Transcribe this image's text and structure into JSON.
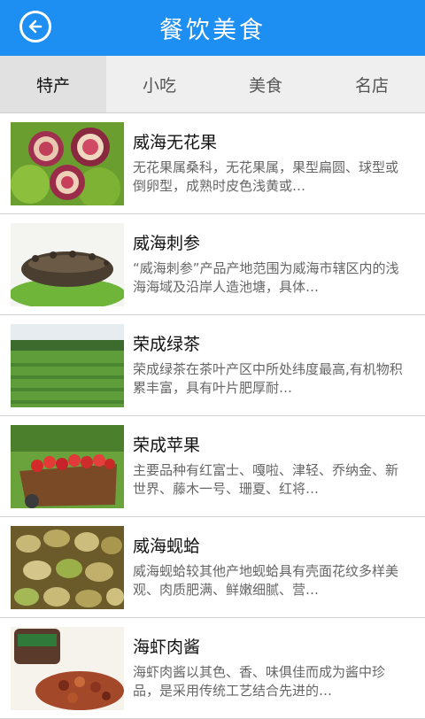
{
  "header": {
    "title": "餐饮美食",
    "back_icon": "back-arrow-icon"
  },
  "tabs": [
    {
      "label": "特产",
      "active": true
    },
    {
      "label": "小吃",
      "active": false
    },
    {
      "label": "美食",
      "active": false
    },
    {
      "label": "名店",
      "active": false
    }
  ],
  "items": [
    {
      "title": "威海无花果",
      "desc": "无花果属桑科，无花果属，果型扁圆、球型或倒卵型，成熟时皮色浅黄或…"
    },
    {
      "title": "威海刺参",
      "desc": "“威海刺参”产品产地范围为威海市辖区内的浅海海域及沿岸人造池塘，具体…"
    },
    {
      "title": "荣成绿茶",
      "desc": "荣成绿茶在茶叶产区中所处纬度最高,有机物积累丰富，具有叶片肥厚耐…"
    },
    {
      "title": "荣成苹果",
      "desc": "主要品种有红富士、嘎啦、津轻、乔纳金、新世界、藤木一号、珊夏、红将…"
    },
    {
      "title": "威海蚬蛤",
      "desc": "威海蚬蛤较其他产地蚬蛤具有壳面花纹多样美观、肉质肥满、鲜嫩细腻、营…"
    },
    {
      "title": "海虾肉酱",
      "desc": "海虾肉酱以其色、香、味俱佳而成为酱中珍品，是采用传统工艺结合先进的…"
    }
  ]
}
